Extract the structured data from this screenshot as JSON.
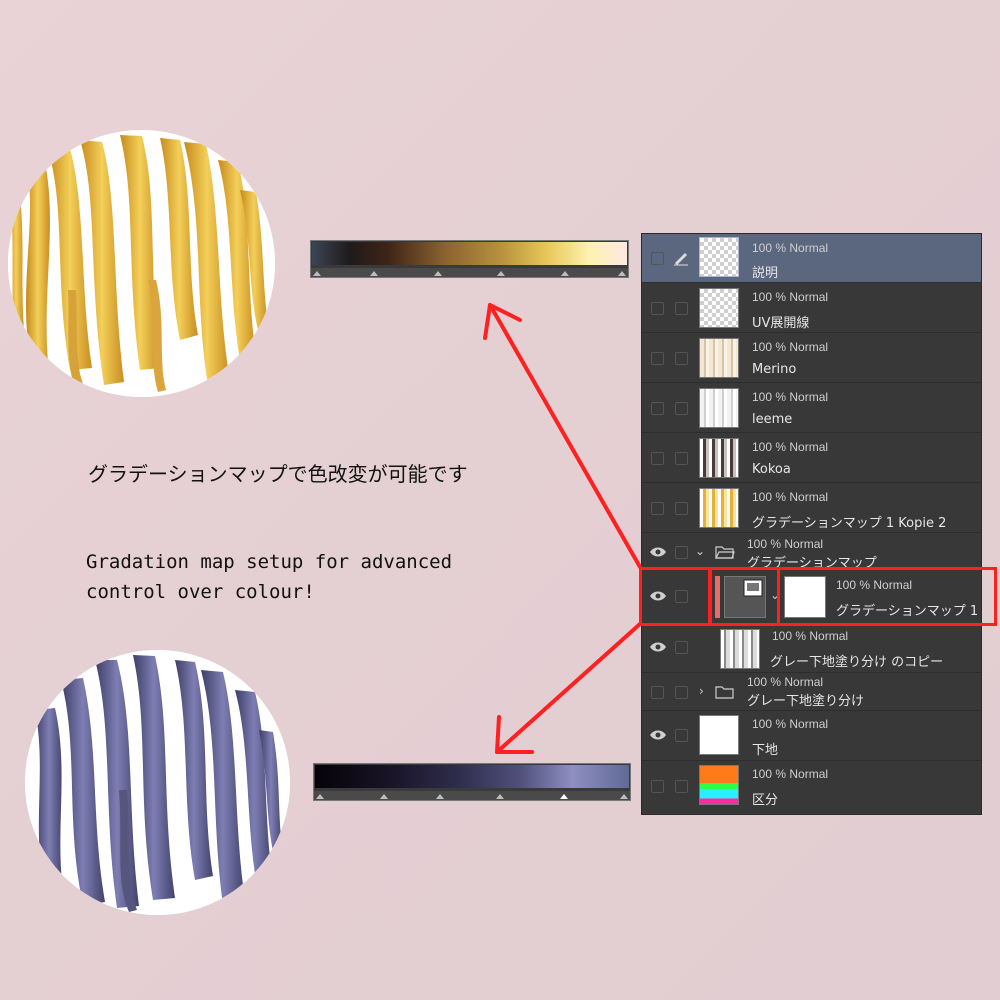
{
  "captions": {
    "jp": "グラデーションマップで色改変が可能です",
    "en_line1": "Gradation map setup for advanced",
    "en_line2": "control over colour!"
  },
  "colors": {
    "arrow": "#ff2020",
    "highlight_box": "#ff2020",
    "panel_bg": "#383838",
    "selected_row": "#5b667f",
    "gold_hair": "#e8b53a",
    "purple_hair": "#6a6a9c"
  },
  "gradient_bars": {
    "gold": {
      "stops": [
        "#3b4656",
        "#1f1a1a",
        "#3e2417",
        "#8a6230",
        "#b7913e",
        "#e9c95a",
        "#fdf2b0",
        "#ffe8e0"
      ]
    },
    "purple": {
      "stops": [
        "#050308",
        "#1a1528",
        "#2e2c4b",
        "#4f4f7a",
        "#8f8fc2",
        "#606a94"
      ]
    }
  },
  "layers": [
    {
      "mode": "100 % Normal",
      "name": "説明",
      "visible": false,
      "selected": true,
      "icon": "pen-icon"
    },
    {
      "mode": "100 % Normal",
      "name": "UV展開線",
      "visible": false
    },
    {
      "mode": "100 % Normal",
      "name": "Merino",
      "visible": false
    },
    {
      "mode": "100 % Normal",
      "name": "leeme",
      "visible": false
    },
    {
      "mode": "100 % Normal",
      "name": "Kokoa",
      "visible": false
    },
    {
      "mode": "100 % Normal",
      "name": "グラデーションマップ 1 Kopie 2",
      "visible": false
    },
    {
      "mode": "100 % Normal",
      "name": "グラデーションマップ",
      "visible": true,
      "type": "folder-open"
    },
    {
      "mode": "100 % Normal",
      "name": "グラデーションマップ 1",
      "visible": true,
      "type": "gradient-map"
    },
    {
      "mode": "100 % Normal",
      "name": "グレー下地塗り分け のコピー",
      "visible": true
    },
    {
      "mode": "100 % Normal",
      "name": "グレー下地塗り分け",
      "visible": false,
      "type": "folder-closed"
    },
    {
      "mode": "100 % Normal",
      "name": "下地",
      "visible": true
    },
    {
      "mode": "100 % Normal",
      "name": "区分",
      "visible": false
    }
  ]
}
